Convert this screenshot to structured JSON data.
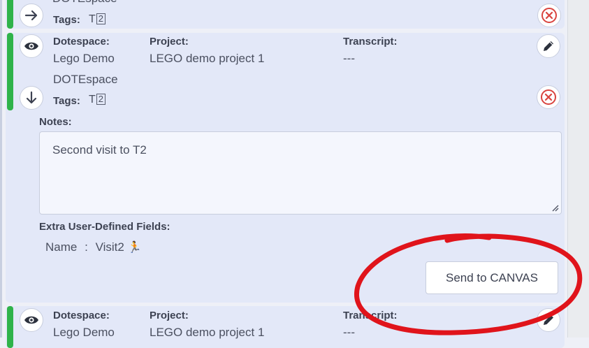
{
  "top_card": {
    "partial_text": "DOTEspace",
    "tags_label": "Tags:",
    "tag_value": "T",
    "tag_box": "2"
  },
  "main_card": {
    "dotespace_label": "Dotespace:",
    "dotespace_value": "Lego Demo",
    "project_label": "Project:",
    "project_value": "LEGO demo project 1",
    "transcript_label": "Transcript:",
    "transcript_value": "---",
    "dotespace_sub": "DOTEspace",
    "tags_label": "Tags:",
    "tag_value": "T",
    "tag_box": "2",
    "notes_label": "Notes:",
    "notes_text": "Second visit to T2",
    "extra_label": "Extra User-Defined Fields:",
    "extra_field_name": "Name",
    "extra_sep": ":",
    "extra_field_value": "Visit2",
    "extra_emoji": "🏃",
    "send_button": "Send to CANVAS"
  },
  "bottom_card": {
    "dotespace_label": "Dotespace:",
    "dotespace_value": "Lego Demo",
    "project_label": "Project:",
    "project_value": "LEGO demo project 1",
    "transcript_label": "Transcript:",
    "transcript_value": "---"
  },
  "colors": {
    "accent_bar": "#2fb34a",
    "delete_red": "#d9443f",
    "annotation_red": "#e0141b",
    "card_bg": "#e3e8f8"
  },
  "icons": [
    "arrow-right-icon",
    "close-circle-icon",
    "eye-icon",
    "pencil-icon",
    "arrow-down-icon"
  ]
}
